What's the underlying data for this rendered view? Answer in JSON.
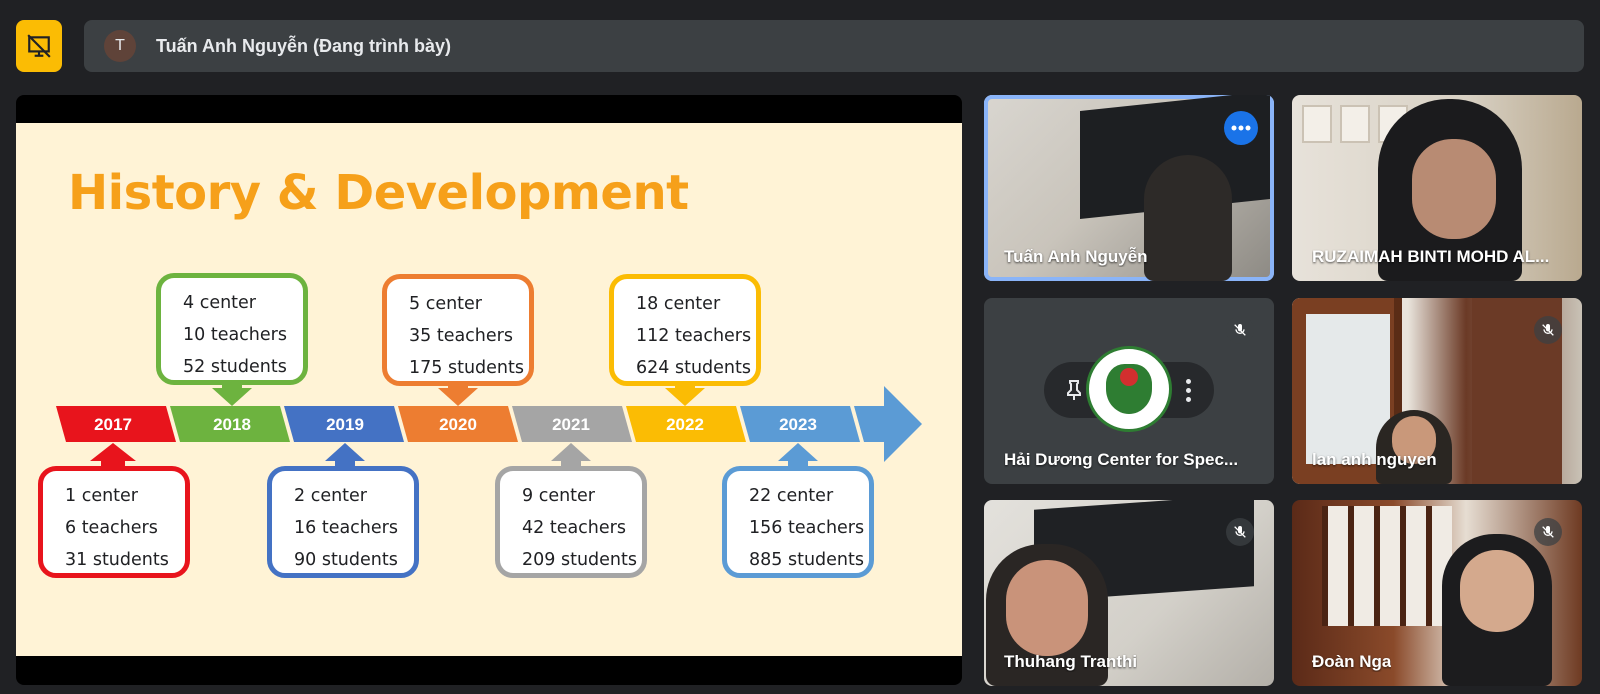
{
  "presenter": {
    "avatar_initial": "T",
    "label": "Tuấn Anh Nguyễn (Đang trình bày)"
  },
  "slide": {
    "title": "History & Development",
    "years": [
      "2017",
      "2018",
      "2019",
      "2020",
      "2021",
      "2022",
      "2023"
    ],
    "colors": {
      "2017": "#e8141c",
      "2018": "#6db33f",
      "2019": "#4472c4",
      "2020": "#ed7d31",
      "2021": "#a5a5a5",
      "2022": "#fbbc04",
      "2023": "#5b9bd5"
    },
    "boxes": [
      {
        "year": "2017",
        "center": "1 center",
        "teachers": "6 teachers",
        "students": "31 students"
      },
      {
        "year": "2018",
        "center": "4 center",
        "teachers": "10 teachers",
        "students": "52 students"
      },
      {
        "year": "2019",
        "center": "2 center",
        "teachers": "16 teachers",
        "students": "90 students"
      },
      {
        "year": "2020",
        "center": "5 center",
        "teachers": "35 teachers",
        "students": "175 students"
      },
      {
        "year": "2021",
        "center": "9 center",
        "teachers": "42 teachers",
        "students": "209 students"
      },
      {
        "year": "2022",
        "center": "18 center",
        "teachers": "112 teachers",
        "students": "624 students"
      },
      {
        "year": "2023",
        "center": "22 center",
        "teachers": "156 teachers",
        "students": "885 students"
      }
    ]
  },
  "participants": [
    {
      "name": "Tuấn Anh Nguyễn",
      "active": true
    },
    {
      "name": "RUZAIMAH BINTI MOHD AL...",
      "active": false
    },
    {
      "name": "Hải Dương Center for Spec...",
      "muted": true
    },
    {
      "name": "lan anh nguyen",
      "muted": true
    },
    {
      "name": "Thuhang Tranthi",
      "muted": true
    },
    {
      "name": "Đoàn Nga",
      "muted": true
    }
  ]
}
